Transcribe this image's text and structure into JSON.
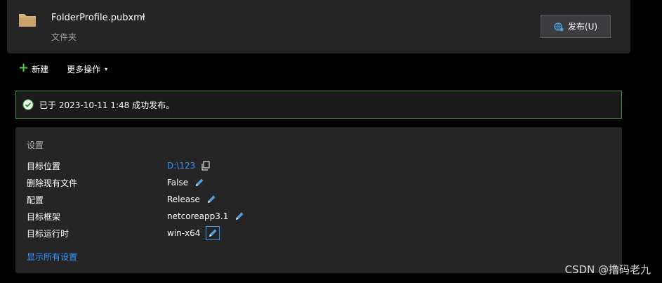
{
  "header": {
    "profile_name": "FolderProfile.pubxml",
    "profile_caret": "▾",
    "profile_type": "文件夹",
    "publish_label": "发布(U)"
  },
  "toolbar": {
    "new_label": "新建",
    "more_label": "更多操作",
    "more_caret": "▾"
  },
  "banner": {
    "message": "已于 2023-10-11 1:48 成功发布。"
  },
  "settings": {
    "title": "设置",
    "rows": [
      {
        "key": "目标位置",
        "value": "D:\\123"
      },
      {
        "key": "删除现有文件",
        "value": "False"
      },
      {
        "key": "配置",
        "value": "Release"
      },
      {
        "key": "目标框架",
        "value": "netcoreapp3.1"
      },
      {
        "key": "目标运行时",
        "value": "win-x64"
      }
    ],
    "show_all": "显示所有设置"
  },
  "watermark": "CSDN @撸码老九",
  "colors": {
    "accent_link": "#3794ff",
    "success_green": "#4ec94e",
    "panel_bg": "#252526",
    "folder_tan": "#d7b27a"
  }
}
